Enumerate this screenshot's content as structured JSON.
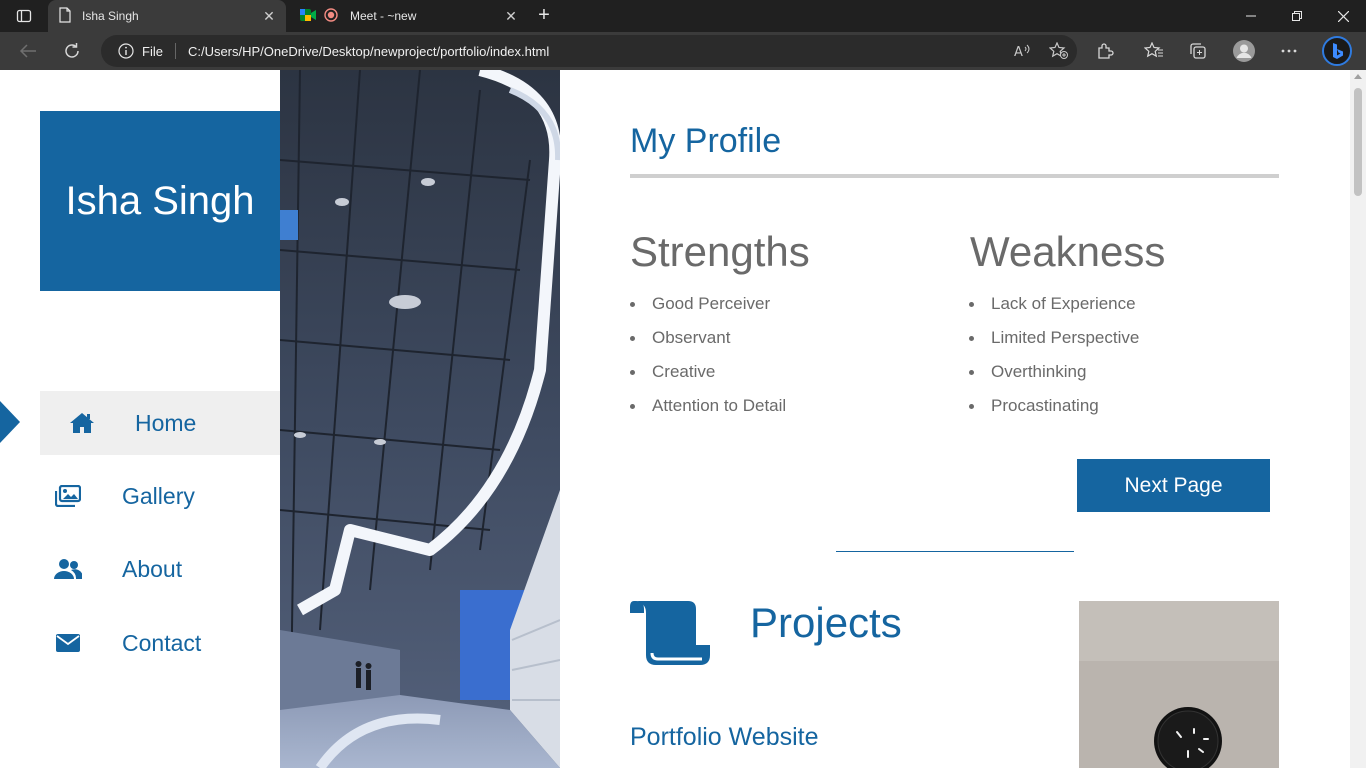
{
  "browser": {
    "tabs": [
      {
        "title": "Isha Singh",
        "active": true
      },
      {
        "title": "Meet - ~new",
        "active": false
      }
    ],
    "address": {
      "scheme_label": "File",
      "url": "C:/Users/HP/OneDrive/Desktop/newproject/portfolio/index.html"
    }
  },
  "site": {
    "name": "Isha Singh",
    "nav": [
      {
        "label": "Home",
        "icon": "home-icon",
        "active": true
      },
      {
        "label": "Gallery",
        "icon": "images-icon",
        "active": false
      },
      {
        "label": "About",
        "icon": "users-icon",
        "active": false
      },
      {
        "label": "Contact",
        "icon": "envelope-icon",
        "active": false
      }
    ],
    "accent_color": "#1565a0"
  },
  "profile": {
    "title": "My Profile",
    "strengths": {
      "title": "Strengths",
      "items": [
        "Good Perceiver",
        "Observant",
        "Creative",
        "Attention to Detail"
      ]
    },
    "weakness": {
      "title": "Weakness",
      "items": [
        "Lack of Experience",
        "Limited Perspective",
        "Overthinking",
        "Procastinating"
      ]
    },
    "next_button": "Next Page"
  },
  "projects": {
    "title": "Projects",
    "icon": "scroll-icon",
    "first_project": "Portfolio Website"
  }
}
